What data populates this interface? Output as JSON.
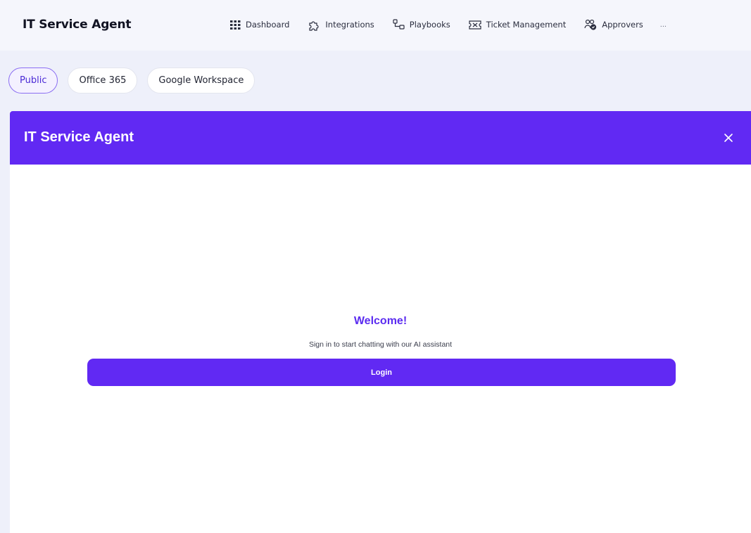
{
  "app": {
    "title": "IT Service Agent"
  },
  "nav": {
    "items": [
      {
        "label": "Dashboard",
        "icon": "grid-icon"
      },
      {
        "label": "Integrations",
        "icon": "puzzle-icon"
      },
      {
        "label": "Playbooks",
        "icon": "workflow-icon"
      },
      {
        "label": "Ticket Management",
        "icon": "ticket-icon"
      },
      {
        "label": "Approvers",
        "icon": "users-check-icon"
      }
    ],
    "more_label": "..."
  },
  "tabs": [
    {
      "label": "Public",
      "active": true
    },
    {
      "label": "Office 365",
      "active": false
    },
    {
      "label": "Google Workspace",
      "active": false
    }
  ],
  "chat_panel": {
    "title": "IT Service Agent",
    "close_icon": "close-icon",
    "welcome_title": "Welcome!",
    "welcome_subtitle": "Sign in to start chatting with our AI assistant",
    "login_label": "Login"
  },
  "colors": {
    "accent": "#6129f3",
    "page_background": "#eef0fa",
    "active_tab_border": "#8b6ef2"
  }
}
